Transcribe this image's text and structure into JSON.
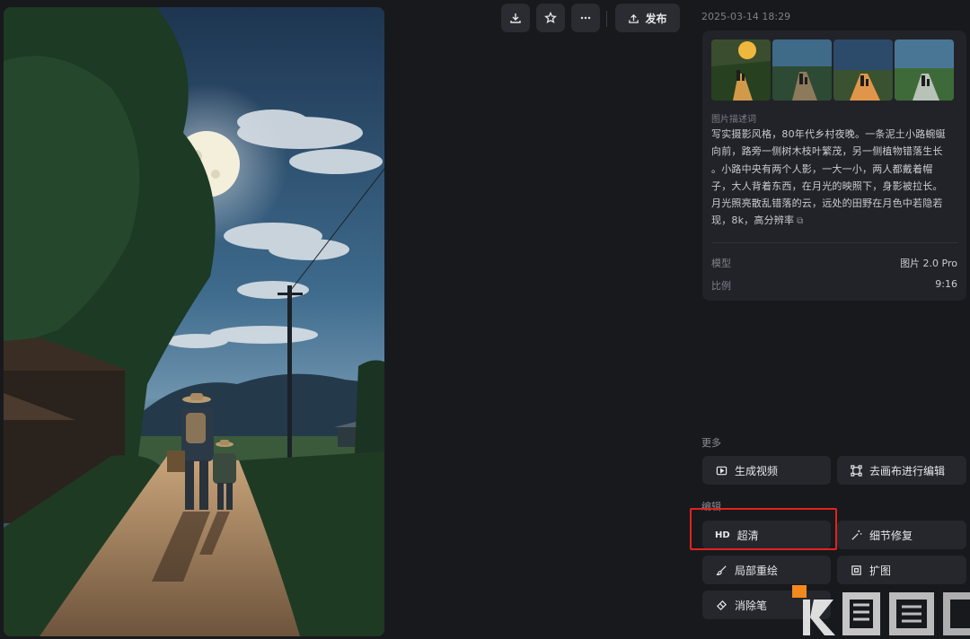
{
  "toolbar": {
    "download_icon": "download-icon",
    "favorite_icon": "star-icon",
    "more_icon": "more-icon",
    "publish_icon": "upload-icon",
    "publish_label": "发布"
  },
  "meta": {
    "date": "2025-03-14 18:29"
  },
  "info_card": {
    "description_title": "图片描述词",
    "description_lines": [
      "写实摄影风格，80年代乡村夜晚。一条泥土小路蜿蜒",
      "向前，路旁一侧树木枝叶繁茂，另一侧植物错落生长",
      "。小路中央有两个人影，一大一小，两人都戴着帽",
      "子，大人背着东西，在月光的映照下，身影被拉长。",
      "月光照亮散乱错落的云，远处的田野在月色中若隐若",
      "现，8k，高分辨率"
    ],
    "copy_icon": "copy-icon",
    "model_label": "模型",
    "model_value": "图片 2.0 Pro",
    "ratio_label": "比例",
    "ratio_value": "9:16"
  },
  "sections": {
    "more_label": "更多",
    "edit_label": "编辑"
  },
  "actions": {
    "generate_video": "生成视频",
    "canvas_edit": "去画布进行编辑",
    "hd_icon_text": "HD",
    "upscale": "超清",
    "detail_repair": "细节修复",
    "inpaint": "局部重绘",
    "expand": "扩图",
    "eraser": "消除笔"
  },
  "colors": {
    "background": "#18191d",
    "card": "#222329",
    "button": "#26272d",
    "highlight": "#e3231d",
    "watermark_orange": "#f5891d"
  }
}
